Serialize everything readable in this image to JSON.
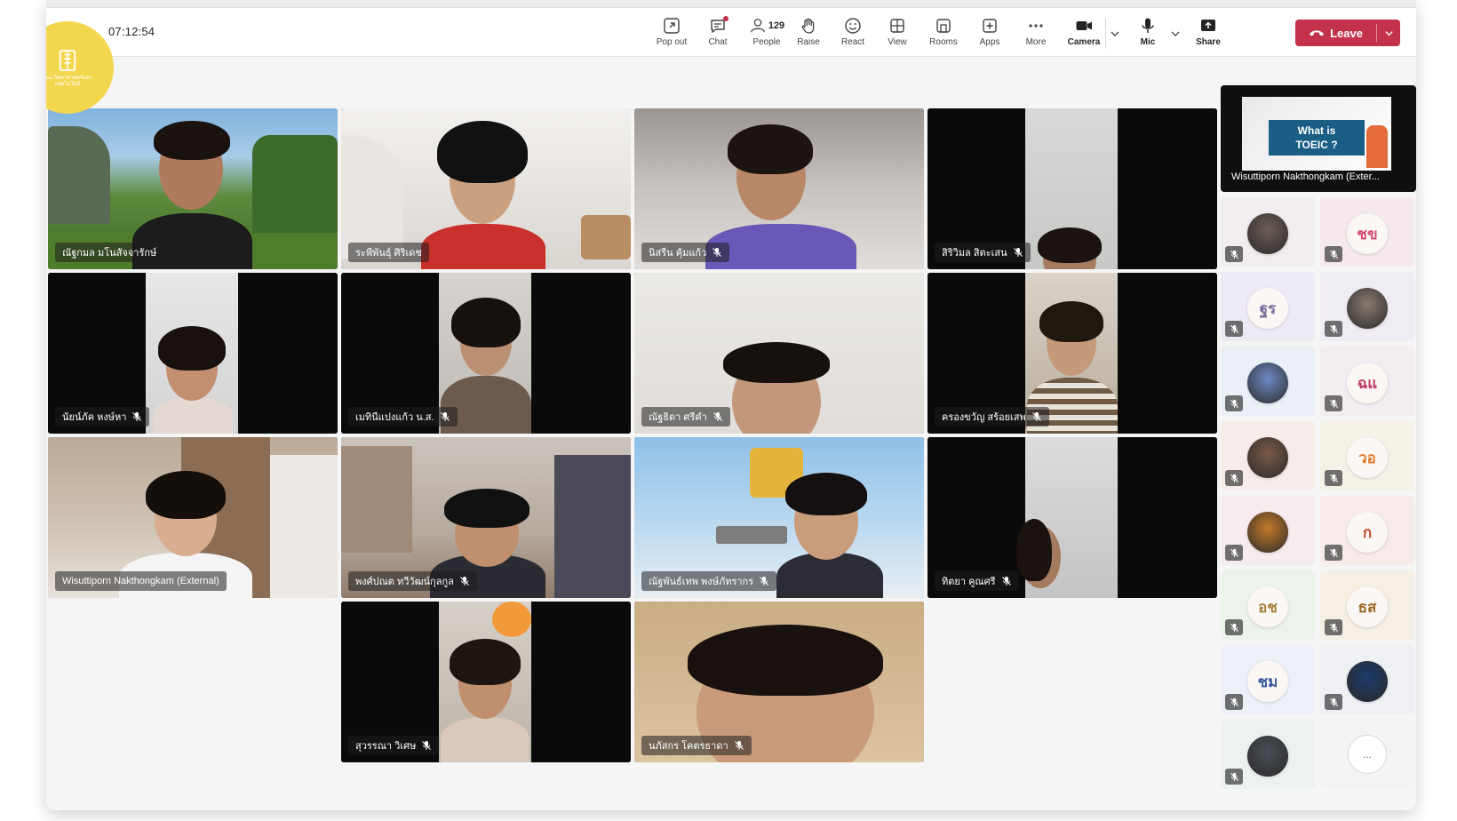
{
  "meeting": {
    "timer": "07:12:54"
  },
  "toolbar": {
    "pop_out": "Pop out",
    "chat": "Chat",
    "people": "People",
    "people_count": "129",
    "raise": "Raise",
    "react": "React",
    "view": "View",
    "rooms": "Rooms",
    "apps": "Apps",
    "more": "More",
    "camera": "Camera",
    "mic": "Mic",
    "share": "Share",
    "leave": "Leave"
  },
  "logo": {
    "text": "คณะวิทยาศาสตร์และเทคโนโลยี"
  },
  "pinned": {
    "slide_line1": "What is",
    "slide_line2": "TOEIC ?",
    "name": "Wisuttiporn Nakthongkam (Exter..."
  },
  "tiles": [
    {
      "name": "ณัฐกมล มโนสัจจารักษ์",
      "muted": false
    },
    {
      "name": "ระพีพันธุ์ ศิริเดช",
      "muted": false
    },
    {
      "name": "นิสรีน คุ้มแก้ว",
      "muted": true
    },
    {
      "name": "สิริวิมล สิตะเสน",
      "muted": true
    },
    {
      "name": "นัยน์ภัค หงษ์หา",
      "muted": true
    },
    {
      "name": "เมทินีแปงแก้ว น.ส.",
      "muted": true
    },
    {
      "name": "ณัฐธิดา ศรีคำ",
      "muted": true
    },
    {
      "name": "ครองขวัญ สร้อยเสพ",
      "muted": true
    },
    {
      "name": "Wisuttiporn Nakthongkam (External)",
      "muted": false
    },
    {
      "name": "พงศ์ปณต ทวีวัฒน์กุลกูล",
      "muted": true
    },
    {
      "name": "ณัฐพันธ์เทพ พงษ์ภัทรากร",
      "muted": true
    },
    {
      "name": "ทิตยา คูณศรี",
      "muted": true
    },
    {
      "name": "สุวรรณา วิเศษ",
      "muted": true
    },
    {
      "name": "นภัสกร โคตรธาดา",
      "muted": true
    }
  ],
  "sidebar": {
    "items": [
      {
        "initials": "",
        "kind": "photo"
      },
      {
        "initials": "ชข",
        "kind": "initials"
      },
      {
        "initials": "ฐร",
        "kind": "initials"
      },
      {
        "initials": "",
        "kind": "photo"
      },
      {
        "initials": "",
        "kind": "photo"
      },
      {
        "initials": "ฉแ",
        "kind": "initials"
      },
      {
        "initials": "",
        "kind": "photo"
      },
      {
        "initials": "วอ",
        "kind": "initials"
      },
      {
        "initials": "",
        "kind": "photo"
      },
      {
        "initials": "ก",
        "kind": "initials"
      },
      {
        "initials": "อช",
        "kind": "initials"
      },
      {
        "initials": "ธส",
        "kind": "initials"
      },
      {
        "initials": "ชม",
        "kind": "initials"
      },
      {
        "initials": "",
        "kind": "photo"
      },
      {
        "initials": "",
        "kind": "photo"
      }
    ],
    "more_label": "..."
  },
  "colors": {
    "leave_red": "#c4314b",
    "logo_yellow": "#f2d74e",
    "slide_blue": "#1a5e86"
  }
}
